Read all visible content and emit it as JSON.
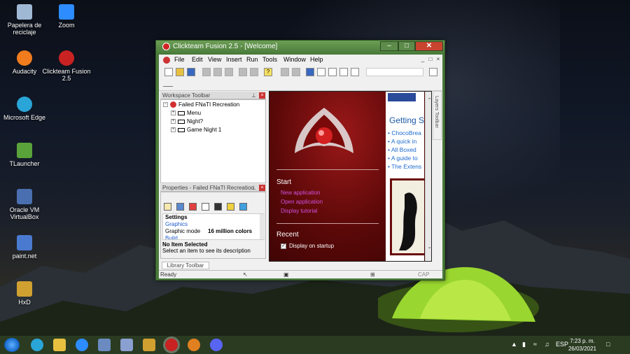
{
  "desktop": {
    "icons": [
      {
        "label": "Papelera de reciclaje",
        "icon": "recycle-bin-icon",
        "color": "#9fb8d4"
      },
      {
        "label": "Zoom",
        "icon": "zoom-icon",
        "color": "#2d8cff"
      },
      {
        "label": "Audacity",
        "icon": "audacity-icon",
        "color": "#f07c1e"
      },
      {
        "label": "Clickteam Fusion 2.5",
        "icon": "clickteam-icon",
        "color": "#c92222"
      },
      {
        "label": "Microsoft Edge",
        "icon": "edge-icon",
        "color": "#2aa5d8"
      },
      {
        "label": "TLauncher",
        "icon": "tlauncher-icon",
        "color": "#5aa33a"
      },
      {
        "label": "Oracle VM VirtualBox",
        "icon": "virtualbox-icon",
        "color": "#4a6fb0"
      },
      {
        "label": "paint.net",
        "icon": "paintnet-icon",
        "color": "#4a7ad0"
      },
      {
        "label": "HxD",
        "icon": "hxd-icon",
        "color": "#d0a030"
      }
    ]
  },
  "window": {
    "title": "Clickteam Fusion 2.5 - [Welcome]",
    "menu": [
      "File",
      "Edit",
      "View",
      "Insert",
      "Run",
      "Tools",
      "Window",
      "Help"
    ],
    "workspace": {
      "title": "Workspace Toolbar",
      "root": "Failed FNaTI Recreation",
      "frames": [
        "Menu",
        "Night?",
        "Game Night 1"
      ]
    },
    "properties": {
      "title": "Properties - Failed FNaTI Recreation",
      "section": "Settings",
      "tab_selected": "Graphics",
      "row_label": "Graphic mode",
      "row_value": "16 million colors",
      "row_cut": "Build",
      "desc_title": "No Item Selected",
      "desc_text": "Select an item to see its description"
    },
    "library_tab": "Library Toolbar",
    "layers_tab": "Layers Toolbar",
    "welcome": {
      "start_heading": "Start",
      "links": [
        "New application",
        "Open application",
        "Display tutorial"
      ],
      "recent_heading": "Recent",
      "display_on_startup": "Display on startup"
    },
    "news": {
      "heading": "Getting S",
      "items": [
        "ChocoBrea",
        "A quick in",
        "All Boxed",
        "A guide to",
        "The Extens"
      ]
    },
    "status": {
      "left": "Ready",
      "right": "CAP"
    }
  },
  "taskbar": {
    "lang": "ESP",
    "time": "7:23 p. m.",
    "date": "26/03/2021"
  }
}
